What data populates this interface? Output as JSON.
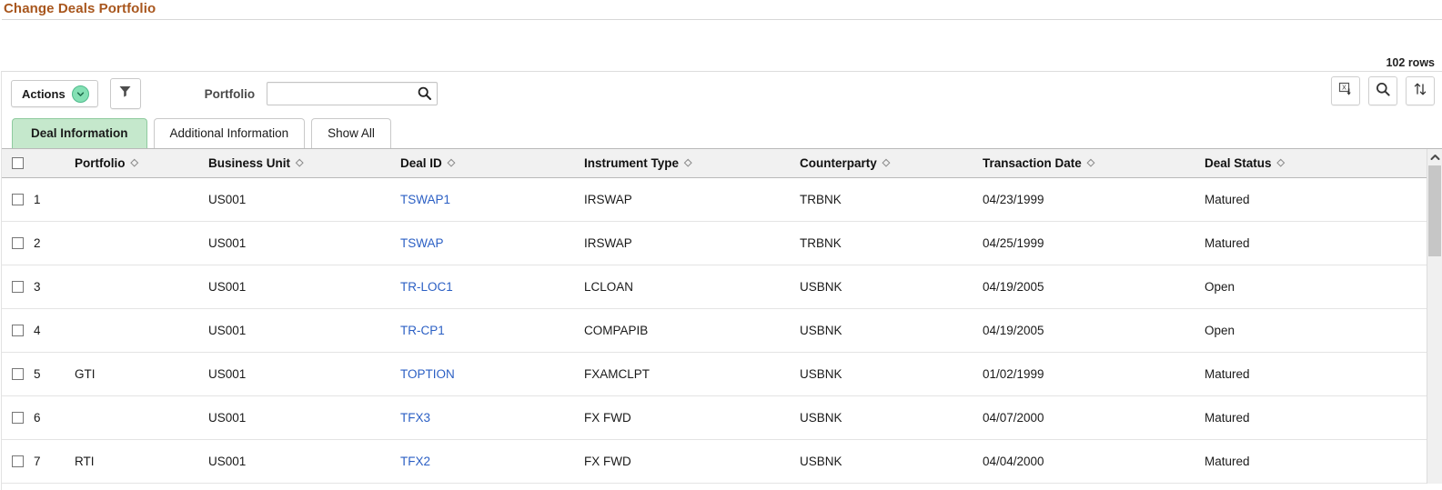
{
  "page": {
    "title": "Change Deals Portfolio"
  },
  "summary": {
    "rows_count": "102 rows"
  },
  "toolbar": {
    "actions_label": "Actions",
    "filter_icon": "filter-icon",
    "portfolio_label": "Portfolio",
    "portfolio_value": "",
    "portfolio_placeholder": "",
    "search_icon": "search-icon",
    "right_buttons": [
      {
        "name": "download-to-excel-button",
        "icon": "excel-download-icon"
      },
      {
        "name": "find-button",
        "icon": "magnifier-icon"
      },
      {
        "name": "sort-button",
        "icon": "sort-updown-icon"
      }
    ]
  },
  "tabs": [
    {
      "label": "Deal Information",
      "active": true
    },
    {
      "label": "Additional Information",
      "active": false
    },
    {
      "label": "Show All",
      "active": false
    }
  ],
  "table": {
    "select_all_checkbox": false,
    "columns": [
      {
        "label": "Portfolio",
        "sortable": true
      },
      {
        "label": "Business Unit",
        "sortable": true
      },
      {
        "label": "Deal ID",
        "sortable": true
      },
      {
        "label": "Instrument Type",
        "sortable": true
      },
      {
        "label": "Counterparty",
        "sortable": true
      },
      {
        "label": "Transaction Date",
        "sortable": true
      },
      {
        "label": "Deal Status",
        "sortable": true
      }
    ],
    "rows": [
      {
        "num": "1",
        "portfolio": "",
        "business_unit": "US001",
        "deal_id": "TSWAP1",
        "instrument_type": "IRSWAP",
        "counterparty": "TRBNK",
        "transaction_date": "04/23/1999",
        "deal_status": "Matured"
      },
      {
        "num": "2",
        "portfolio": "",
        "business_unit": "US001",
        "deal_id": "TSWAP",
        "instrument_type": "IRSWAP",
        "counterparty": "TRBNK",
        "transaction_date": "04/25/1999",
        "deal_status": "Matured"
      },
      {
        "num": "3",
        "portfolio": "",
        "business_unit": "US001",
        "deal_id": "TR-LOC1",
        "instrument_type": "LCLOAN",
        "counterparty": "USBNK",
        "transaction_date": "04/19/2005",
        "deal_status": "Open"
      },
      {
        "num": "4",
        "portfolio": "",
        "business_unit": "US001",
        "deal_id": "TR-CP1",
        "instrument_type": "COMPAPIB",
        "counterparty": "USBNK",
        "transaction_date": "04/19/2005",
        "deal_status": "Open"
      },
      {
        "num": "5",
        "portfolio": "GTI",
        "business_unit": "US001",
        "deal_id": "TOPTION",
        "instrument_type": "FXAMCLPT",
        "counterparty": "USBNK",
        "transaction_date": "01/02/1999",
        "deal_status": "Matured"
      },
      {
        "num": "6",
        "portfolio": "",
        "business_unit": "US001",
        "deal_id": "TFX3",
        "instrument_type": "FX FWD",
        "counterparty": "USBNK",
        "transaction_date": "04/07/2000",
        "deal_status": "Matured"
      },
      {
        "num": "7",
        "portfolio": "RTI",
        "business_unit": "US001",
        "deal_id": "TFX2",
        "instrument_type": "FX FWD",
        "counterparty": "USBNK",
        "transaction_date": "04/04/2000",
        "deal_status": "Matured"
      }
    ]
  },
  "scrollbar": {
    "up_arrow_icon": "chevron-up-icon"
  },
  "colors": {
    "title": "#a8561d",
    "active_tab_bg": "#c5e8cc",
    "link": "#2b5fc4",
    "header_bg": "#f1f1f1"
  }
}
